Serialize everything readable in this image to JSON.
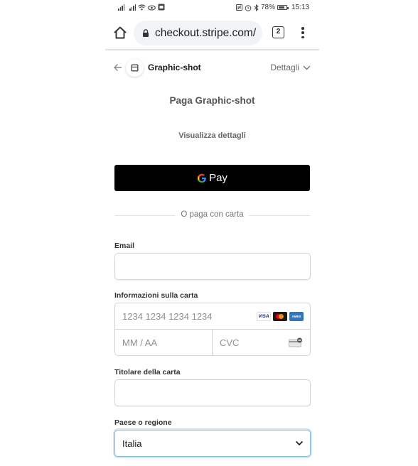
{
  "status_bar": {
    "icons": [
      "signal-icon",
      "signal-icon",
      "wifi-icon",
      "eye-icon",
      "notification-icon",
      "nfc-icon",
      "alarm-icon",
      "bluetooth-icon",
      "battery-icon"
    ],
    "battery": "78%",
    "time": "15:13"
  },
  "browser": {
    "url": "checkout.stripe.com/",
    "tab_count": "2"
  },
  "checkout": {
    "merchant": "Graphic-shot",
    "details_label": "Dettagli",
    "pay_title": "Paga Graphic-shot",
    "view_details": "Visualizza dettagli",
    "gpay_label": "Pay",
    "divider_text": "O paga con carta",
    "email_label": "Email",
    "email_value": "",
    "card_label": "Informazioni sulla carta",
    "card_number_placeholder": "1234 1234 1234 1234",
    "card_brands": [
      "VISA",
      "Mastercard",
      "AMEX"
    ],
    "expiry_placeholder": "MM / AA",
    "cvc_placeholder": "CVC",
    "cardholder_label": "Titolare della carta",
    "cardholder_value": "",
    "country_label": "Paese o regione",
    "country_value": "Italia"
  },
  "colors": {
    "gpay_bg": "#000000",
    "focus_border": "#82b7d6",
    "url_bar_bg": "#f1f3f4"
  }
}
